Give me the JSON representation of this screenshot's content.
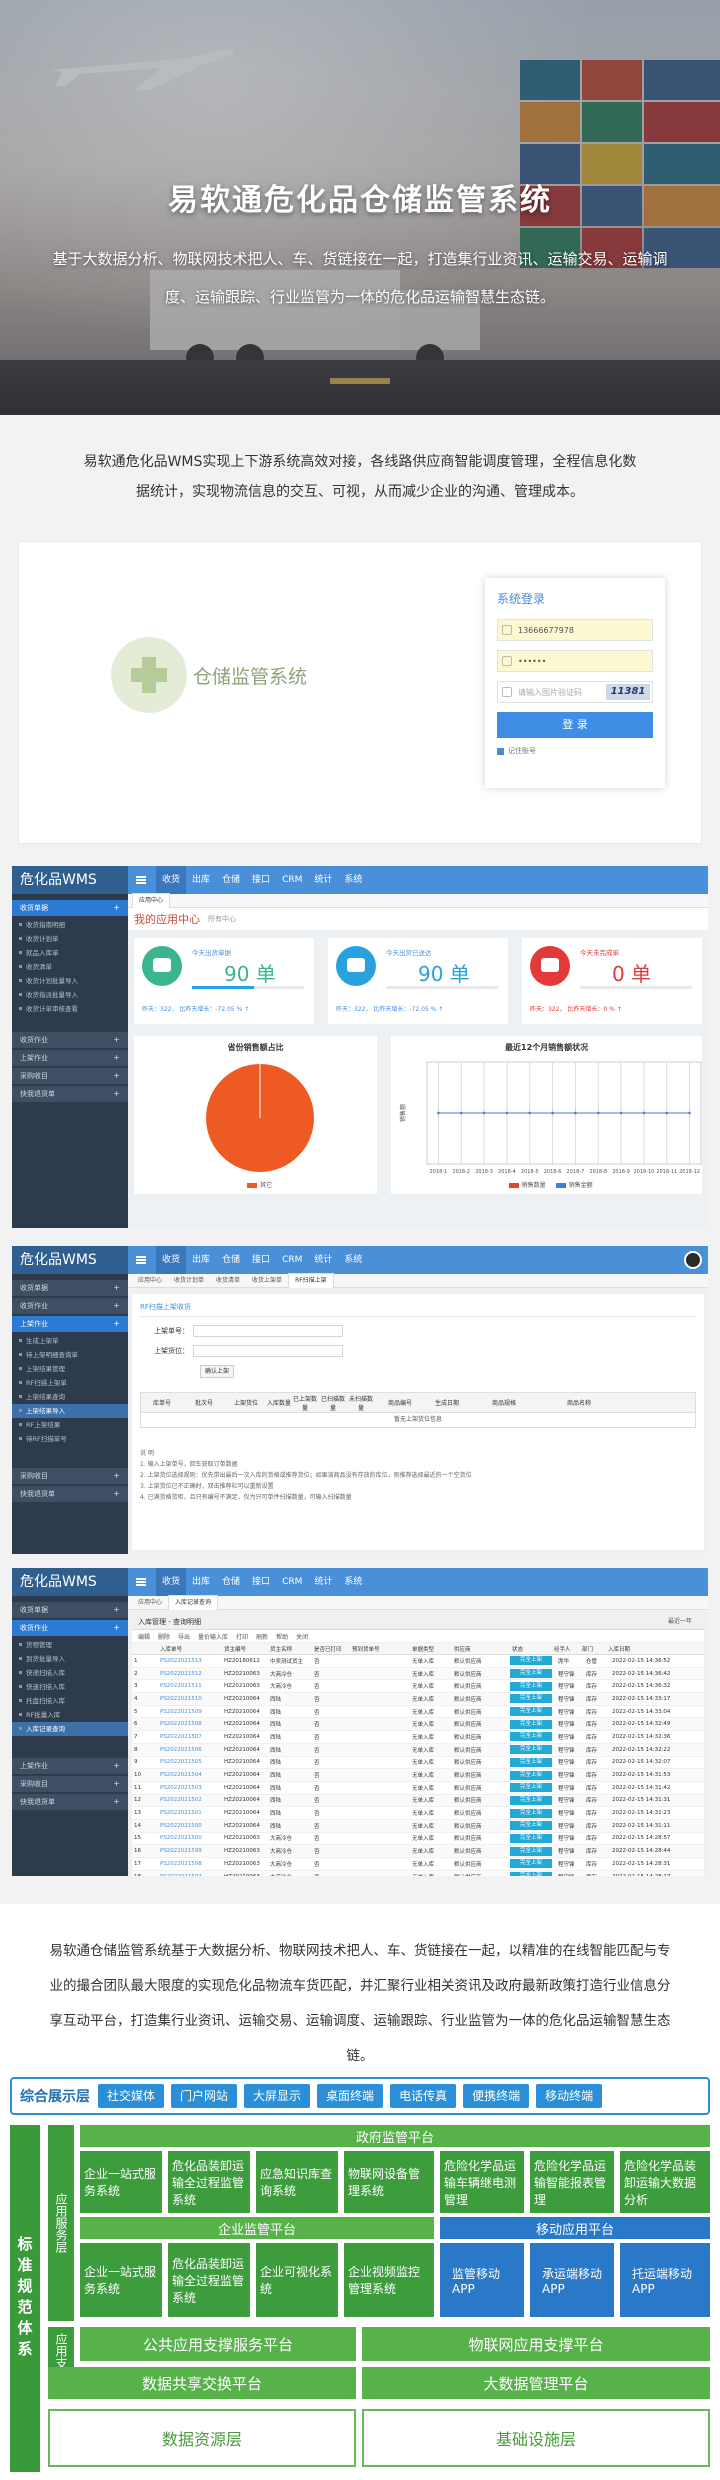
{
  "hero": {
    "title": "易软通危化品仓储监管系统",
    "description": "基于大数据分析、物联网技术把人、车、货链接在一起，打造集行业资讯、运输交易、运输调度、运输跟踪、行业监管为一体的危化品运输智慧生态链。"
  },
  "intro": "易软通危化品WMS实现上下游系统高效对接，各线路供应商智能调度管理，全程信息化数据统计，实现物流信息的交互、可视，从而减少企业的沟通、管理成本。",
  "login": {
    "logo_text": "仓储监管系统",
    "box_title": "系统登录",
    "username_value": "13666677978",
    "password_value": "••••••",
    "captcha_placeholder": "请输入图片验证码",
    "captcha_value": "11381",
    "login_button": "登 录",
    "remember": "记住账号"
  },
  "app": {
    "brand": "危化品WMS",
    "nav": [
      "收货",
      "出库",
      "仓储",
      "接口",
      "CRM",
      "统计",
      "系统"
    ]
  },
  "screen1": {
    "sidebar_head": "收货单据",
    "sidebar_items": [
      "收货指南明细",
      "收货计划单",
      "就品入库单",
      "收货清单",
      "收货计划批量导入",
      "收货指派批量导入",
      "收货计单审核查看"
    ],
    "sidebar_groups": [
      "收货作业",
      "上架作业",
      "采购收目",
      "快我退货单"
    ],
    "tabs": [
      "应用中心"
    ],
    "crumb_title": "我的应用中心",
    "crumb_sub": "所有中心",
    "cards": [
      {
        "label": "今天出货单据",
        "value": "90 单",
        "foot": "昨天：322，  比昨天增长：-72.05 %  ↑",
        "color": "#3bb58f",
        "progress": 0.55
      },
      {
        "label": "今天出货已送达",
        "value": "90 单",
        "foot": "昨天：322，  比昨天增长：-72.05 %  ↑",
        "color": "#27a2de",
        "progress": 0.55
      },
      {
        "label": "今天未完成单",
        "value": "0 单",
        "foot": "昨天：322，  比昨天增长：0 %  ↑",
        "color": "#e23a3a",
        "progress": 0.0
      }
    ],
    "pie": {
      "title": "省份销售额占比",
      "legend": "其它",
      "color": "#ee5a24"
    },
    "chart_data": {
      "type": "line",
      "title": "最近12个月销售额状况",
      "categories": [
        "2018-1",
        "2018-2",
        "2018-3",
        "2018-4",
        "2018-5",
        "2018-6",
        "2018-7",
        "2018-8",
        "2018-9",
        "2018-10",
        "2018-11",
        "2018-12"
      ],
      "ylabel": "销售额",
      "series": [
        {
          "name": "销售数量",
          "color": "#e5462e",
          "values": [
            0,
            0,
            0,
            0,
            0,
            0,
            0,
            0,
            0,
            0,
            0,
            0
          ]
        },
        {
          "name": "销售金额",
          "color": "#3d7fd6",
          "values": [
            0,
            0,
            0,
            0,
            0,
            0,
            0,
            0,
            0,
            0,
            0,
            0
          ]
        }
      ]
    }
  },
  "screen2": {
    "sidebar_heads": [
      "收货单据",
      "收货作业",
      "上架作业"
    ],
    "sidebar_items": [
      "生成上架单",
      "待上架明细查询单",
      "上架结果管理",
      "RF扫描上架单",
      "上架结果查询",
      "上架结果导入",
      "RF上架结果",
      "待RF扫描单号"
    ],
    "sidebar_groups": [
      "采购收目",
      "快我退货单"
    ],
    "tabs": [
      "应用中心",
      "收货计划单",
      "收货清单",
      "收货上架单",
      "RF扫描上架"
    ],
    "panel_title": "RF扫描上架收货",
    "field1": "上架单号：",
    "field2": "上架货位：",
    "button": "确认上架",
    "columns": [
      "库单号",
      "批次号",
      "上架货位",
      "入库数量",
      "已上架数量",
      "已扫描数量",
      "未扫描数量",
      "商品编号",
      "生成日期",
      "商品规格",
      "商品名称"
    ],
    "empty": "暂无上架货位信息",
    "notes": [
      "说 明",
      "1. 输入上架单号，回车获取订单数据",
      "2. 上架货位选择规则：优先带出最后一次入库的货格或推荐货位；如果该商品没有存放的库位，则推荐选择最近的一个空货位",
      "3. 上架货位已不正确时，双击推荐栏可以重新设置",
      "4. 已满货格货柜，且只有编号不满足，仅为只可单件扫描数量，可输入扫描数量"
    ]
  },
  "screen3": {
    "sidebar_heads": [
      "收货单据",
      "收货作业"
    ],
    "sidebar_items": [
      "货物管理",
      "到货批量导入",
      "快递扫描入库",
      "快速扫描入库",
      "托盘扫描入库",
      "RF批量入库",
      "入库记录查询"
    ],
    "sidebar_groups": [
      "上架作业",
      "采购收目",
      "快我退货单"
    ],
    "tabs": [
      "应用中心",
      "入库记录查询"
    ],
    "panel_title": "入库管理 - 查询明细",
    "recent": "最近一年",
    "tools": [
      "编辑",
      "删除",
      "导出",
      "量价输入库",
      "打印",
      "刷新",
      "帮助",
      "关闭"
    ],
    "columns": [
      "",
      "入库单号",
      "货主编号",
      "货主名称",
      "是否已打印",
      "预到货单号",
      "单据类型",
      "供应商",
      "状态",
      "经手人",
      "部门",
      "入库日期"
    ],
    "rows": [
      [
        "1",
        "PS2022021513",
        "HZ20180612",
        "中奖测试货主",
        "否",
        "",
        "无单入库",
        "默认供应商",
        "完全上架",
        "席华",
        "仓管",
        "2022-02-15 14:36:52"
      ],
      [
        "2",
        "PS2022021512",
        "HZ20210063",
        "大商冷仓",
        "否",
        "",
        "无单入库",
        "默认供应商",
        "完全上架",
        "程守锋",
        "库存",
        "2022-02-15 14:36:42"
      ],
      [
        "3",
        "PS2022021511",
        "HZ20210063",
        "大商冷仓",
        "否",
        "",
        "无单入库",
        "默认供应商",
        "完全上架",
        "程守锋",
        "库存",
        "2022-02-15 14:36:32"
      ],
      [
        "4",
        "PS2022021510",
        "HZ20210064",
        "西陆",
        "否",
        "",
        "无单入库",
        "默认供应商",
        "完全上架",
        "程守锋",
        "库存",
        "2022-02-15 14:33:17"
      ],
      [
        "5",
        "PS2022021509",
        "HZ20210064",
        "西陆",
        "否",
        "",
        "无单入库",
        "默认供应商",
        "完全上架",
        "程守锋",
        "库存",
        "2022-02-15 14:33:04"
      ],
      [
        "6",
        "PS2022021508",
        "HZ20210064",
        "西陆",
        "否",
        "",
        "无单入库",
        "默认供应商",
        "完全上架",
        "程守锋",
        "库存",
        "2022-02-15 14:32:49"
      ],
      [
        "7",
        "PS2022021507",
        "HZ20210064",
        "西陆",
        "否",
        "",
        "无单入库",
        "默认供应商",
        "完全上架",
        "程守锋",
        "库存",
        "2022-02-15 14:32:36"
      ],
      [
        "8",
        "PS2022021506",
        "HZ20210064",
        "西陆",
        "否",
        "",
        "无单入库",
        "默认供应商",
        "完全上架",
        "程守锋",
        "库存",
        "2022-02-15 14:32:22"
      ],
      [
        "9",
        "PS2022021505",
        "HZ20210064",
        "西陆",
        "否",
        "",
        "无单入库",
        "默认供应商",
        "完全上架",
        "程守锋",
        "库存",
        "2022-02-15 14:32:07"
      ],
      [
        "10",
        "PS2022021504",
        "HZ20210064",
        "西陆",
        "否",
        "",
        "无单入库",
        "默认供应商",
        "完全上架",
        "程守锋",
        "库存",
        "2022-02-15 14:31:53"
      ],
      [
        "11",
        "PS2022021503",
        "HZ20210064",
        "西陆",
        "否",
        "",
        "无单入库",
        "默认供应商",
        "完全上架",
        "程守锋",
        "库存",
        "2022-02-15 14:31:42"
      ],
      [
        "12",
        "PS2022021502",
        "HZ20210064",
        "西陆",
        "否",
        "",
        "无单入库",
        "默认供应商",
        "完全上架",
        "程守锋",
        "库存",
        "2022-02-15 14:31:31"
      ],
      [
        "13",
        "PS2022021501",
        "HZ20210064",
        "西陆",
        "否",
        "",
        "无单入库",
        "默认供应商",
        "完全上架",
        "程守锋",
        "库存",
        "2022-02-15 14:31:23"
      ],
      [
        "14",
        "PS2022021500",
        "HZ20210064",
        "西陆",
        "否",
        "",
        "无单入库",
        "默认供应商",
        "完全上架",
        "程守锋",
        "库存",
        "2022-02-15 14:31:11"
      ],
      [
        "15",
        "PS2022021500",
        "HZ20210063",
        "大商冷仓",
        "否",
        "",
        "无单入库",
        "默认供应商",
        "完全上架",
        "程守锋",
        "库存",
        "2022-02-15 14:28:57"
      ],
      [
        "16",
        "PS2022021599",
        "HZ20210063",
        "大商冷仓",
        "否",
        "",
        "无单入库",
        "默认供应商",
        "完全上架",
        "程守锋",
        "库存",
        "2022-02-15 14:28:44"
      ],
      [
        "17",
        "PS2022021598",
        "HZ20210063",
        "大商冷仓",
        "否",
        "",
        "无单入库",
        "默认供应商",
        "完全上架",
        "程守锋",
        "库存",
        "2022-02-15 14:28:31"
      ],
      [
        "18",
        "PS2022021597",
        "HZ20210063",
        "大商冷仓",
        "否",
        "",
        "无单入库",
        "默认供应商",
        "完全上架",
        "程守锋",
        "库存",
        "2022-02-15 14:28:17"
      ]
    ]
  },
  "summary": "易软通仓储监管系统基于大数据分析、物联网技术把人、车、货链接在一起，以精准的在线智能匹配与专业的撮合团队最大限度的实现危化品物流车货匹配，并汇聚行业相关资讯及政府最新政策打造行业信息分享互动平台，打造集行业资讯、运输交易、运输调度、运输跟踪、行业监管为一体的危化品运输智慧生态链。",
  "arch": {
    "row1_label": "综合展示层",
    "row1_items": [
      "社交媒体",
      "门户网站",
      "大屏显示",
      "桌面终端",
      "电话传真",
      "便携终端",
      "移动终端"
    ],
    "side_label": "标准规范体系",
    "sub_service": "应用服务层",
    "sub_support": "应用支撑层",
    "gov_title": "政府监管平台",
    "gov_items": [
      "企业一站式服务系统",
      "危化品装卸运输全过程监管系统",
      "应急知识库查询系统",
      "物联网设备管理系统",
      "危险化学品运输车辆继电测管理",
      "危险化学品运输智能报表管理",
      "危险化学品装卸运输大数据分析"
    ],
    "ent_title": "企业监管平台",
    "ent_items": [
      "企业一站式服务系统",
      "危化品装卸运输全过程监管系统",
      "企业可视化系统",
      "企业视频监控管理系统"
    ],
    "mobile_title": "移动应用平台",
    "mobile_items": [
      "监管移动APP",
      "承运端移动APP",
      "托运端移动APP"
    ],
    "support_left": "公共应用支撑服务平台",
    "support_right": "物联网应用支撑平台",
    "exchange": "数据共享交换平台",
    "datamgmt": "大数据管理平台",
    "bottom_left": "数据资源层",
    "bottom_right": "基础设施层"
  }
}
